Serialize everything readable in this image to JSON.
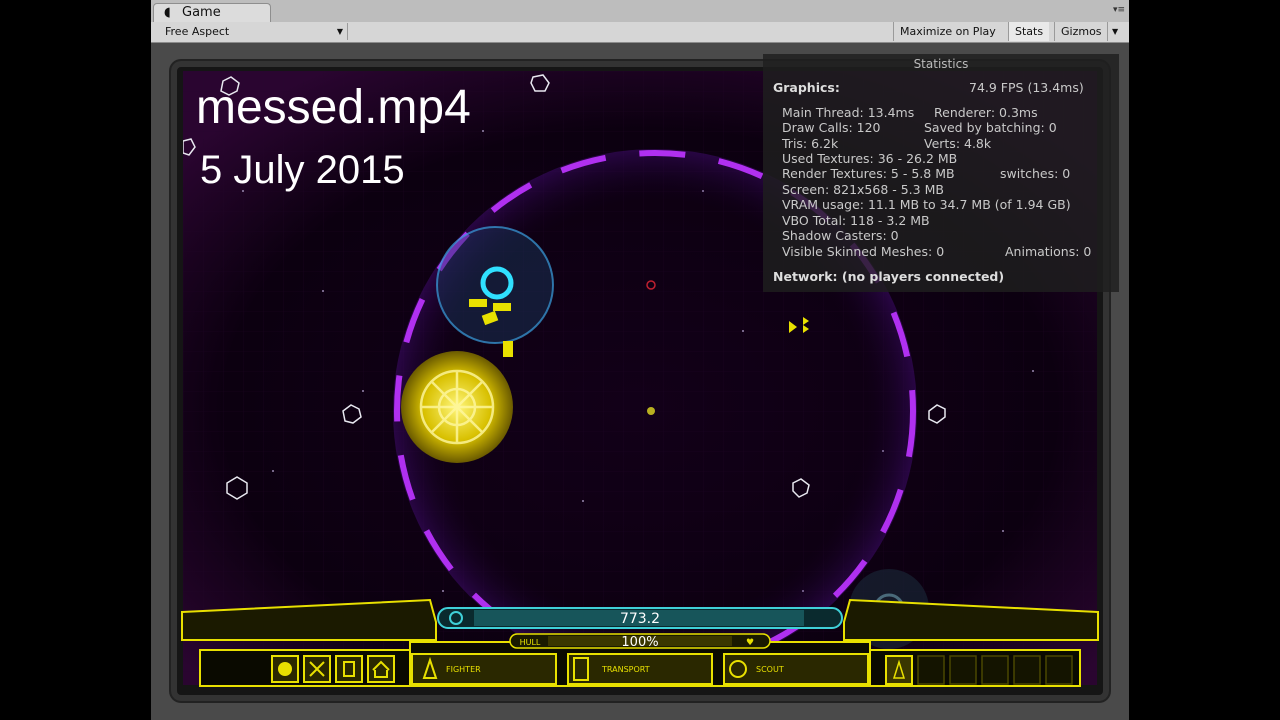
{
  "window": {
    "tab_title": "Game",
    "tab_icon": "unity-icon"
  },
  "toolbar": {
    "aspect": "Free Aspect",
    "maximize": "Maximize on Play",
    "stats": "Stats",
    "gizmos": "Gizmos"
  },
  "video_overlay": {
    "filename": "messed.mp4",
    "date": "5 July 2015"
  },
  "stats": {
    "header": "Statistics",
    "graphics_label": "Graphics:",
    "fps": "74.9 FPS (13.4ms)",
    "main_thread": "Main Thread: 13.4ms",
    "renderer": "Renderer: 0.3ms",
    "draw_calls": "Draw Calls: 120",
    "saved_batching": "Saved by batching: 0",
    "tris": "Tris: 6.2k",
    "verts": "Verts: 4.8k",
    "used_textures": "Used Textures: 36 - 26.2 MB",
    "render_textures": "Render Textures: 5 - 5.8 MB",
    "switches": "switches: 0",
    "screen": "Screen: 821x568 - 5.3 MB",
    "vram": "VRAM usage: 11.1 MB to 34.7 MB (of 1.94 GB)",
    "vbo": "VBO Total: 118 - 3.2 MB",
    "shadow": "Shadow Casters: 0",
    "skinned": "Visible Skinned Meshes: 0",
    "animations": "Animations: 0",
    "network": "Network: (no players connected)"
  },
  "hud": {
    "energy_value": "773.2",
    "hull_label": "HULL",
    "hull_value": "100%",
    "hull_fraction": 1.0,
    "ship_buttons": [
      {
        "label": "FIGHTER",
        "icon": "fighter-icon"
      },
      {
        "label": "TRANSPORT",
        "icon": "transport-icon"
      },
      {
        "label": "SCOUT",
        "icon": "scout-icon"
      }
    ],
    "action_icons": [
      "stop-icon",
      "expand-icon",
      "fuel-icon",
      "home-icon"
    ]
  },
  "colors": {
    "hud_yellow": "#e8e000",
    "energy_cyan": "#3fd0d8",
    "field_purple": "#a020e0"
  }
}
